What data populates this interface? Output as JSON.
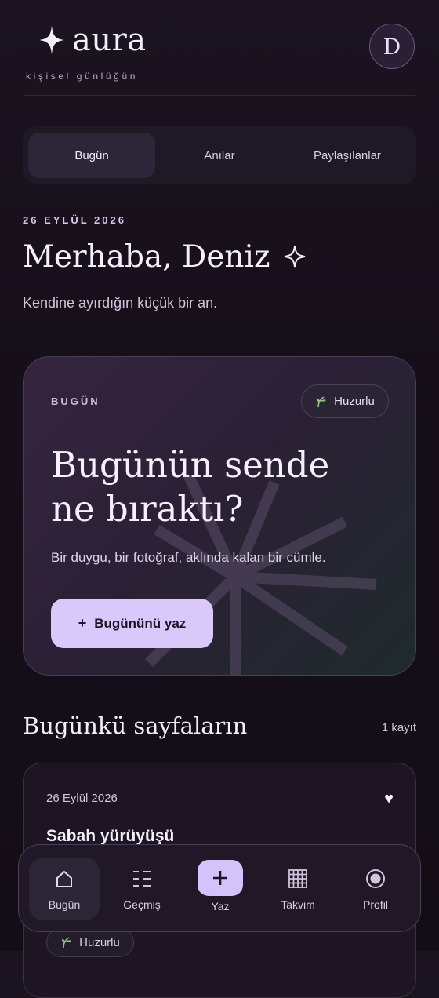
{
  "app": {
    "name": "aura",
    "tagline": "kişisel günlüğün",
    "avatar_initial": "D"
  },
  "tabs": [
    {
      "label": "Bugün",
      "active": true
    },
    {
      "label": "Anılar",
      "active": false
    },
    {
      "label": "Paylaşılanlar",
      "active": false
    }
  ],
  "today": {
    "date_label": "26 EYLÜL 2026",
    "greeting": "Merhaba, Deniz",
    "subtitle": "Kendine ayırdığın küçük bir an."
  },
  "hero": {
    "label": "BUGÜN",
    "mood": "Huzurlu",
    "title": "Bugünün sende ne bıraktı?",
    "description": "Bir duygu, bir fotoğraf, aklında kalan bir cümle.",
    "button_label": "Bugününü yaz",
    "button_icon": "+"
  },
  "pages_section": {
    "title": "Bugünkü sayfaların",
    "count": "1 kayıt"
  },
  "entries": [
    {
      "date": "26 Eylül 2026",
      "title": "Sabah yürüyüşü",
      "mood": "Huzurlu",
      "favorite_icon": "heart-icon"
    }
  ],
  "nav": [
    {
      "label": "Bugün",
      "icon": "home-icon",
      "active": true
    },
    {
      "label": "Geçmiş",
      "icon": "list-icon",
      "active": false
    },
    {
      "label": "Yaz",
      "icon": "plus-icon",
      "active": false
    },
    {
      "label": "Takvim",
      "icon": "grid-icon",
      "active": false
    },
    {
      "label": "Profil",
      "icon": "profile-icon",
      "active": false
    }
  ],
  "colors": {
    "accent": "#d9c9fb",
    "background": "#160f1a",
    "card_border": "#4a3e58"
  }
}
